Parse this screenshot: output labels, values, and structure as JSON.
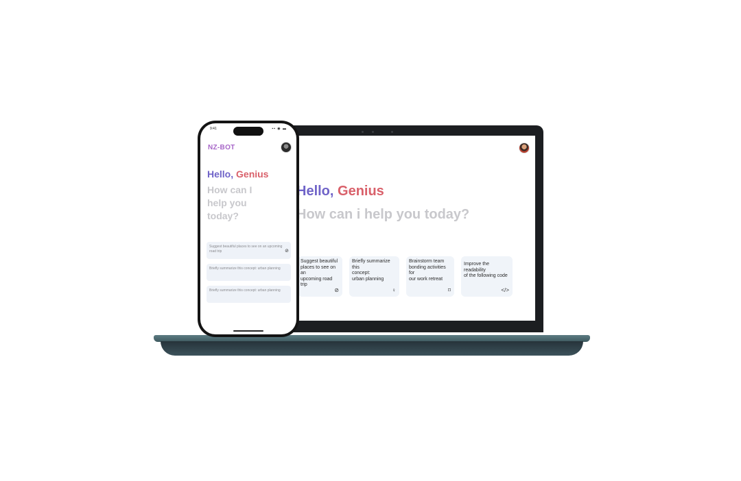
{
  "colors": {
    "greeting_primary": "#6f63c8",
    "greeting_accent": "#d9606a",
    "subtitle": "#c8c8cc",
    "brand": "#a766c8",
    "card_bg": "#f0f4f9",
    "laptop_body": "#1c1e21",
    "laptop_base": "#3f5a60"
  },
  "laptop": {
    "greeting_hello": "Hello, ",
    "greeting_name": "Genius",
    "subtitle": "How can i help you today?",
    "cards": [
      {
        "lines": [
          "Suggest beautiful",
          "places to see on an",
          "upcoming road trip"
        ],
        "icon": "compass-icon",
        "glyph": "⊘"
      },
      {
        "lines": [
          "Briefly summarize this",
          "concept:",
          "urban planning"
        ],
        "icon": "lightbulb-icon",
        "glyph": "♀"
      },
      {
        "lines": [
          "Brainstorm team",
          "bonding activities for",
          "our work retreat"
        ],
        "icon": "chat-icon",
        "glyph": "⌑"
      },
      {
        "lines": [
          "Improve the readability",
          "of the following code"
        ],
        "icon": "code-icon",
        "glyph": "</>"
      }
    ]
  },
  "phone": {
    "status_time": "9:41",
    "status_icons": "▪▪ ◉ ▬",
    "brand": "NZ-BOT",
    "greeting_hello": "Hello, ",
    "greeting_name": "Genius",
    "subtitle": "How can I help you today?",
    "cards": [
      {
        "text": "Suggest beautiful places to see on an upcoming road trip",
        "icon": "compass-icon",
        "glyph": "⊘"
      },
      {
        "text": "Briefly summarize this concept: urban planning",
        "icon": "",
        "glyph": ""
      },
      {
        "text": "Briefly summarize this concept: urban planning",
        "icon": "",
        "glyph": ""
      }
    ]
  }
}
